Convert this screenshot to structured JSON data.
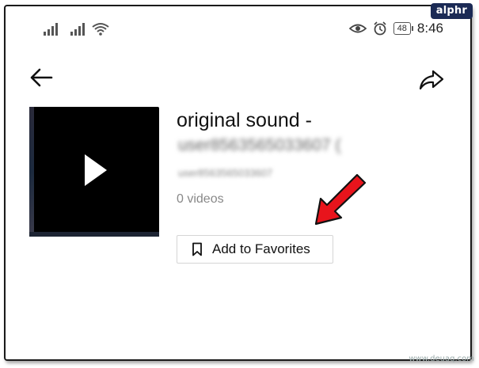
{
  "watermark_badge": "alphr",
  "status_bar": {
    "battery": "48",
    "time": "8:46"
  },
  "sound": {
    "title": "original sound -",
    "author_blurred": "user8563565033607 (",
    "handle_blurred": "user8563565033607",
    "video_count": "0 videos"
  },
  "favorites_button": {
    "label": "Add to Favorites"
  },
  "icons": {
    "back": "arrow-left-icon",
    "share": "share-icon",
    "play": "play-icon",
    "bookmark": "bookmark-icon"
  },
  "annotation": {
    "arrow_color": "#e8141c"
  },
  "footer_watermark": "www.deuaq.com"
}
